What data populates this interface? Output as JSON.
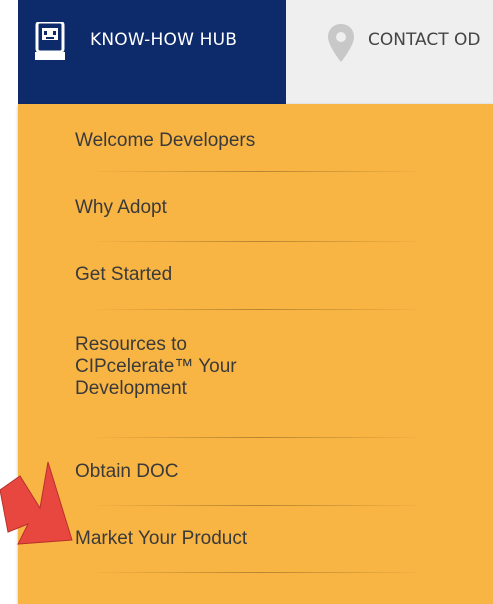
{
  "nav": {
    "tabs": [
      {
        "label": "KNOW-HOW HUB",
        "icon": "robot-icon",
        "active": true
      },
      {
        "label": "CONTACT OD",
        "icon": "map-pin-icon",
        "active": false
      }
    ]
  },
  "menu": {
    "items": [
      {
        "label": "Welcome Developers"
      },
      {
        "label": "Why Adopt"
      },
      {
        "label": "Get Started"
      },
      {
        "label": "Resources to CIPcelerate™ Your Development"
      },
      {
        "label": "Obtain DOC"
      },
      {
        "label": "Market Your Product"
      }
    ]
  },
  "colors": {
    "nav_active": "#0d2a6b",
    "nav_inactive": "#efefef",
    "menu_bg": "#f9b543",
    "arrow": "#e8473f"
  },
  "annotation": {
    "icon": "red-arrow-icon"
  }
}
